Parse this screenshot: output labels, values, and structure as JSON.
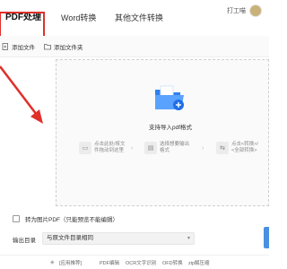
{
  "tabs": {
    "pdf": "PDF处理",
    "word": "Word转换",
    "other": "其他文件转换"
  },
  "user": {
    "name": "打工喵"
  },
  "toolbar": {
    "add_file": "添加文件",
    "add_folder": "添加文件夹"
  },
  "dropzone": {
    "hint": "支持导入pdf格式",
    "steps": [
      {
        "text": "点击此处/将文\n件拖动到这里"
      },
      {
        "text": "选择想要输出\n格式"
      },
      {
        "text": "点击<转换>/\n<全部转换>"
      }
    ]
  },
  "options": {
    "to_image_pdf": "转为图片PDF（只能预览不能编辑）"
  },
  "output": {
    "label": "输出目录",
    "value": "与原文件目录相同"
  },
  "footer": {
    "links": [
      "[应用推荐]",
      "PDF编辑",
      "OCR文字识别",
      "OFD转换",
      "zip解压缩"
    ]
  },
  "colors": {
    "accent": "#4a90e2",
    "highlight": "#e0302a"
  }
}
